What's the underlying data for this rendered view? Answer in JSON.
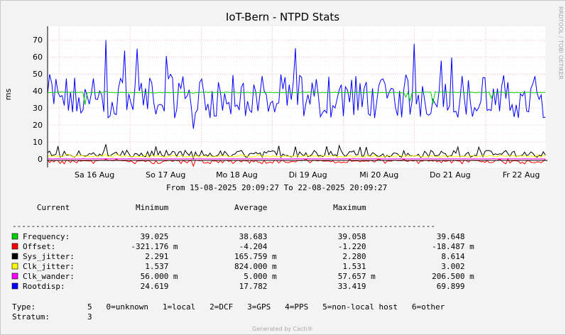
{
  "chart_data": {
    "type": "line",
    "title": "IoT-Bern - NTPD Stats",
    "ylabel": "ms",
    "ylim": [
      -5,
      78
    ],
    "y_ticks": [
      "0",
      "10",
      "20",
      "30",
      "40",
      "50",
      "60",
      "70"
    ],
    "x_ticks": [
      "Sa 16 Aug",
      "So 17 Aug",
      "Mo 18 Aug",
      "Di 19 Aug",
      "Mi 20 Aug",
      "Do 21 Aug",
      "Fr 22 Aug"
    ],
    "grid": true,
    "period": "From 15-08-2025 20:09:27 To 22-08-2025 20:09:27",
    "watermark": "RRDTOOL / TOBI OETIKER",
    "series": [
      {
        "name": "Frequency",
        "color": "#00cf00",
        "current": 39.025,
        "min": 38.683,
        "avg": 39.058,
        "max": 39.648
      },
      {
        "name": "Offset",
        "color": "#ff0000",
        "current": -0.321176,
        "min": -4.204,
        "avg": -1.22,
        "max": -0.018487
      },
      {
        "name": "Sys_jitter",
        "color": "#000000",
        "current": 2.291,
        "min": 0.165759,
        "avg": 2.28,
        "max": 8.614
      },
      {
        "name": "Clk_jitter",
        "color": "#ffff00",
        "current": 1.537,
        "min": 0.824,
        "avg": 1.531,
        "max": 3.002
      },
      {
        "name": "Clk_wander",
        "color": "#ff00ff",
        "current": 0.056,
        "min": 0.005,
        "avg": 0.057657,
        "max": 0.2065
      },
      {
        "name": "Rootdisp",
        "color": "#0000ff",
        "current": 24.619,
        "min": 17.782,
        "avg": 33.419,
        "max": 69.899
      }
    ],
    "legend": {
      "header": "   Current              Minimum              Average              Maximum",
      "separator": "------------------------------------------------------------------------------------------",
      "rows": [
        {
          "label": "Frequency:  ",
          "text": "             39.025               38.683               39.058               39.648"
        },
        {
          "label": "Offset:     ",
          "text": "           -321.176 m             -4.204               -1.220              -18.487 m"
        },
        {
          "label": "Sys_jitter: ",
          "text": "              2.291              165.759 m              2.280                8.614"
        },
        {
          "label": "Clk_jitter: ",
          "text": "              1.537              824.000 m              1.531                3.002"
        },
        {
          "label": "Clk_wander: ",
          "text": "             56.000 m              5.000 m             57.657 m            206.500 m"
        },
        {
          "label": "Rootdisp:   ",
          "text": "             24.619               17.782               33.419               69.899"
        }
      ]
    },
    "footer": {
      "type_line": "Type:           5   0=unknown   1=local   2=DCF   3=GPS   4=PPS   5=non-local host   6=other",
      "stratum_line": "Stratum:        3"
    },
    "generated_by": "Generated by Cacti®"
  }
}
